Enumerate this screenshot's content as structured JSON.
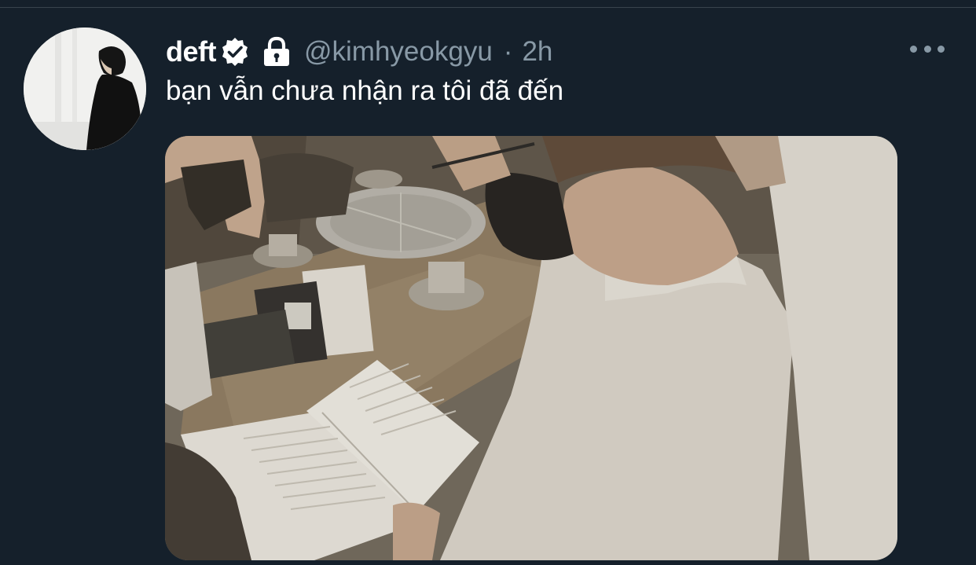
{
  "user": {
    "display_name": "deft",
    "handle": "@kimhyeokgyu",
    "separator": "·",
    "timestamp": "2h",
    "verified": true,
    "protected": true
  },
  "tweet": {
    "text": "bạn vẫn chưa nhận ra tôi đã đến"
  },
  "icons": {
    "verified": "verified-badge-icon",
    "protected": "lock-icon",
    "more": "more-horizontal-icon"
  },
  "colors": {
    "background": "#15202b",
    "primary_text": "#ffffff",
    "secondary_text": "#8899a6",
    "divider": "#38444d"
  }
}
